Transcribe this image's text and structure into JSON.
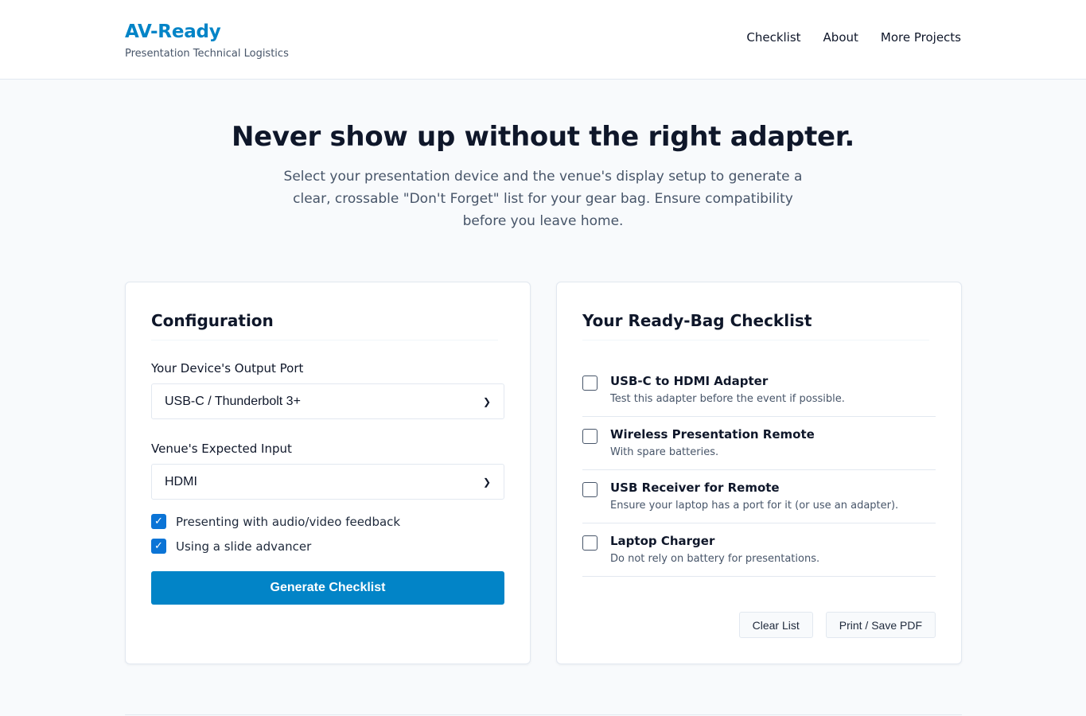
{
  "brand": {
    "title": "AV-Ready",
    "tagline": "Presentation Technical Logistics"
  },
  "nav": [
    {
      "label": "Checklist"
    },
    {
      "label": "About"
    },
    {
      "label": "More Projects"
    }
  ],
  "hero": {
    "title": "Never show up without the right adapter.",
    "subtitle": "Select your presentation device and the venue's display setup to generate a clear, crossable \"Don't Forget\" list for your gear bag. Ensure compatibility before you leave home."
  },
  "config": {
    "title": "Configuration",
    "device_label": "Your Device's Output Port",
    "device_value": "USB-C / Thunderbolt 3+",
    "venue_label": "Venue's Expected Input",
    "venue_value": "HDMI",
    "options": [
      {
        "label": "Presenting with audio/video feedback",
        "checked": true
      },
      {
        "label": "Using a slide advancer",
        "checked": true
      }
    ],
    "generate_label": "Generate Checklist"
  },
  "checklist": {
    "title": "Your Ready-Bag Checklist",
    "items": [
      {
        "title": "USB-C to HDMI Adapter",
        "note": "Test this adapter before the event if possible.",
        "checked": false
      },
      {
        "title": "Wireless Presentation Remote",
        "note": "With spare batteries.",
        "checked": false
      },
      {
        "title": "USB Receiver for Remote",
        "note": "Ensure your laptop has a port for it (or use an adapter).",
        "checked": false
      },
      {
        "title": "Laptop Charger",
        "note": "Do not rely on battery for presentations.",
        "checked": false
      }
    ],
    "clear_label": "Clear List",
    "print_label": "Print / Save PDF"
  },
  "colors": {
    "accent": "#0284c7",
    "checkbox": "#0b74d6"
  }
}
